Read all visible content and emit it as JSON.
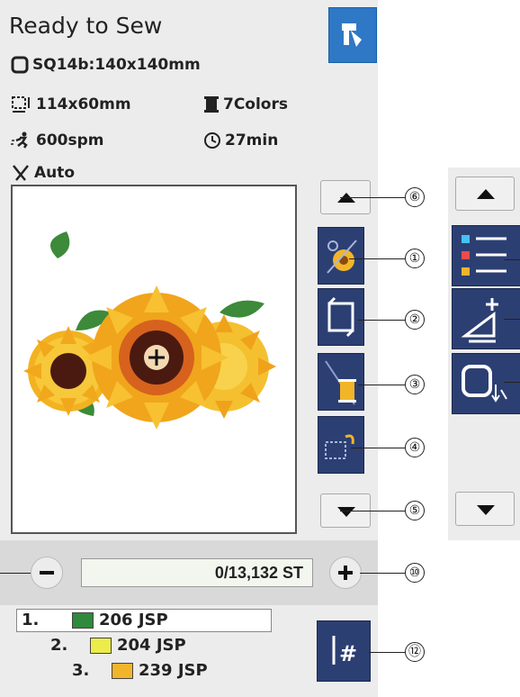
{
  "header": {
    "title": "Ready to Sew",
    "hoop": "SQ14b:140x140mm",
    "design_size": "114x60mm",
    "colors": "7Colors",
    "speed": "600spm",
    "time": "27min",
    "thread_cut": "Auto"
  },
  "stitch": {
    "counter": "0/13,132 ST"
  },
  "color_list": [
    {
      "index": "1.",
      "code": "206 JSP",
      "color": "#2f8a3c"
    },
    {
      "index": "2.",
      "code": "204 JSP",
      "color": "#ecec4a"
    },
    {
      "index": "3.",
      "code": "239 JSP",
      "color": "#f2b52a"
    }
  ],
  "callouts": {
    "c1": "①",
    "c2": "②",
    "c3": "③",
    "c4": "④",
    "c5": "⑤",
    "c6": "⑥",
    "c10": "⑩",
    "c12": "⑫"
  },
  "icons": {
    "back": "back-arrow-icon",
    "hoop": "hoop-icon",
    "size": "design-size-icon",
    "spool": "thread-spool-icon",
    "speed": "running-man-icon",
    "clock": "clock-icon",
    "cutter": "thread-cutter-icon"
  },
  "colors": {
    "accent_blue": "#2f78c5",
    "tool_navy": "#2c3f73"
  }
}
